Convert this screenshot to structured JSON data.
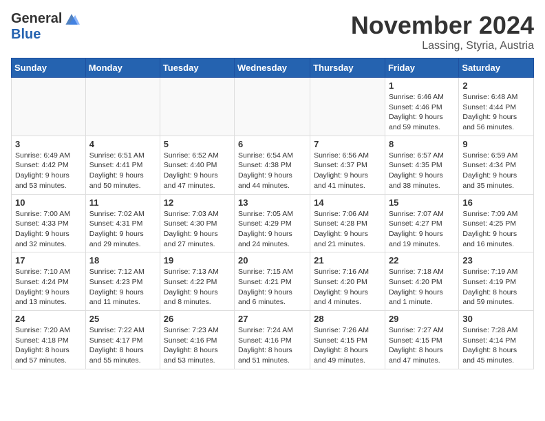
{
  "logo": {
    "general": "General",
    "blue": "Blue"
  },
  "title": "November 2024",
  "location": "Lassing, Styria, Austria",
  "days_of_week": [
    "Sunday",
    "Monday",
    "Tuesday",
    "Wednesday",
    "Thursday",
    "Friday",
    "Saturday"
  ],
  "weeks": [
    [
      {
        "day": "",
        "info": ""
      },
      {
        "day": "",
        "info": ""
      },
      {
        "day": "",
        "info": ""
      },
      {
        "day": "",
        "info": ""
      },
      {
        "day": "",
        "info": ""
      },
      {
        "day": "1",
        "info": "Sunrise: 6:46 AM\nSunset: 4:46 PM\nDaylight: 9 hours and 59 minutes."
      },
      {
        "day": "2",
        "info": "Sunrise: 6:48 AM\nSunset: 4:44 PM\nDaylight: 9 hours and 56 minutes."
      }
    ],
    [
      {
        "day": "3",
        "info": "Sunrise: 6:49 AM\nSunset: 4:42 PM\nDaylight: 9 hours and 53 minutes."
      },
      {
        "day": "4",
        "info": "Sunrise: 6:51 AM\nSunset: 4:41 PM\nDaylight: 9 hours and 50 minutes."
      },
      {
        "day": "5",
        "info": "Sunrise: 6:52 AM\nSunset: 4:40 PM\nDaylight: 9 hours and 47 minutes."
      },
      {
        "day": "6",
        "info": "Sunrise: 6:54 AM\nSunset: 4:38 PM\nDaylight: 9 hours and 44 minutes."
      },
      {
        "day": "7",
        "info": "Sunrise: 6:56 AM\nSunset: 4:37 PM\nDaylight: 9 hours and 41 minutes."
      },
      {
        "day": "8",
        "info": "Sunrise: 6:57 AM\nSunset: 4:35 PM\nDaylight: 9 hours and 38 minutes."
      },
      {
        "day": "9",
        "info": "Sunrise: 6:59 AM\nSunset: 4:34 PM\nDaylight: 9 hours and 35 minutes."
      }
    ],
    [
      {
        "day": "10",
        "info": "Sunrise: 7:00 AM\nSunset: 4:33 PM\nDaylight: 9 hours and 32 minutes."
      },
      {
        "day": "11",
        "info": "Sunrise: 7:02 AM\nSunset: 4:31 PM\nDaylight: 9 hours and 29 minutes."
      },
      {
        "day": "12",
        "info": "Sunrise: 7:03 AM\nSunset: 4:30 PM\nDaylight: 9 hours and 27 minutes."
      },
      {
        "day": "13",
        "info": "Sunrise: 7:05 AM\nSunset: 4:29 PM\nDaylight: 9 hours and 24 minutes."
      },
      {
        "day": "14",
        "info": "Sunrise: 7:06 AM\nSunset: 4:28 PM\nDaylight: 9 hours and 21 minutes."
      },
      {
        "day": "15",
        "info": "Sunrise: 7:07 AM\nSunset: 4:27 PM\nDaylight: 9 hours and 19 minutes."
      },
      {
        "day": "16",
        "info": "Sunrise: 7:09 AM\nSunset: 4:25 PM\nDaylight: 9 hours and 16 minutes."
      }
    ],
    [
      {
        "day": "17",
        "info": "Sunrise: 7:10 AM\nSunset: 4:24 PM\nDaylight: 9 hours and 13 minutes."
      },
      {
        "day": "18",
        "info": "Sunrise: 7:12 AM\nSunset: 4:23 PM\nDaylight: 9 hours and 11 minutes."
      },
      {
        "day": "19",
        "info": "Sunrise: 7:13 AM\nSunset: 4:22 PM\nDaylight: 9 hours and 8 minutes."
      },
      {
        "day": "20",
        "info": "Sunrise: 7:15 AM\nSunset: 4:21 PM\nDaylight: 9 hours and 6 minutes."
      },
      {
        "day": "21",
        "info": "Sunrise: 7:16 AM\nSunset: 4:20 PM\nDaylight: 9 hours and 4 minutes."
      },
      {
        "day": "22",
        "info": "Sunrise: 7:18 AM\nSunset: 4:20 PM\nDaylight: 9 hours and 1 minute."
      },
      {
        "day": "23",
        "info": "Sunrise: 7:19 AM\nSunset: 4:19 PM\nDaylight: 8 hours and 59 minutes."
      }
    ],
    [
      {
        "day": "24",
        "info": "Sunrise: 7:20 AM\nSunset: 4:18 PM\nDaylight: 8 hours and 57 minutes."
      },
      {
        "day": "25",
        "info": "Sunrise: 7:22 AM\nSunset: 4:17 PM\nDaylight: 8 hours and 55 minutes."
      },
      {
        "day": "26",
        "info": "Sunrise: 7:23 AM\nSunset: 4:16 PM\nDaylight: 8 hours and 53 minutes."
      },
      {
        "day": "27",
        "info": "Sunrise: 7:24 AM\nSunset: 4:16 PM\nDaylight: 8 hours and 51 minutes."
      },
      {
        "day": "28",
        "info": "Sunrise: 7:26 AM\nSunset: 4:15 PM\nDaylight: 8 hours and 49 minutes."
      },
      {
        "day": "29",
        "info": "Sunrise: 7:27 AM\nSunset: 4:15 PM\nDaylight: 8 hours and 47 minutes."
      },
      {
        "day": "30",
        "info": "Sunrise: 7:28 AM\nSunset: 4:14 PM\nDaylight: 8 hours and 45 minutes."
      }
    ]
  ]
}
